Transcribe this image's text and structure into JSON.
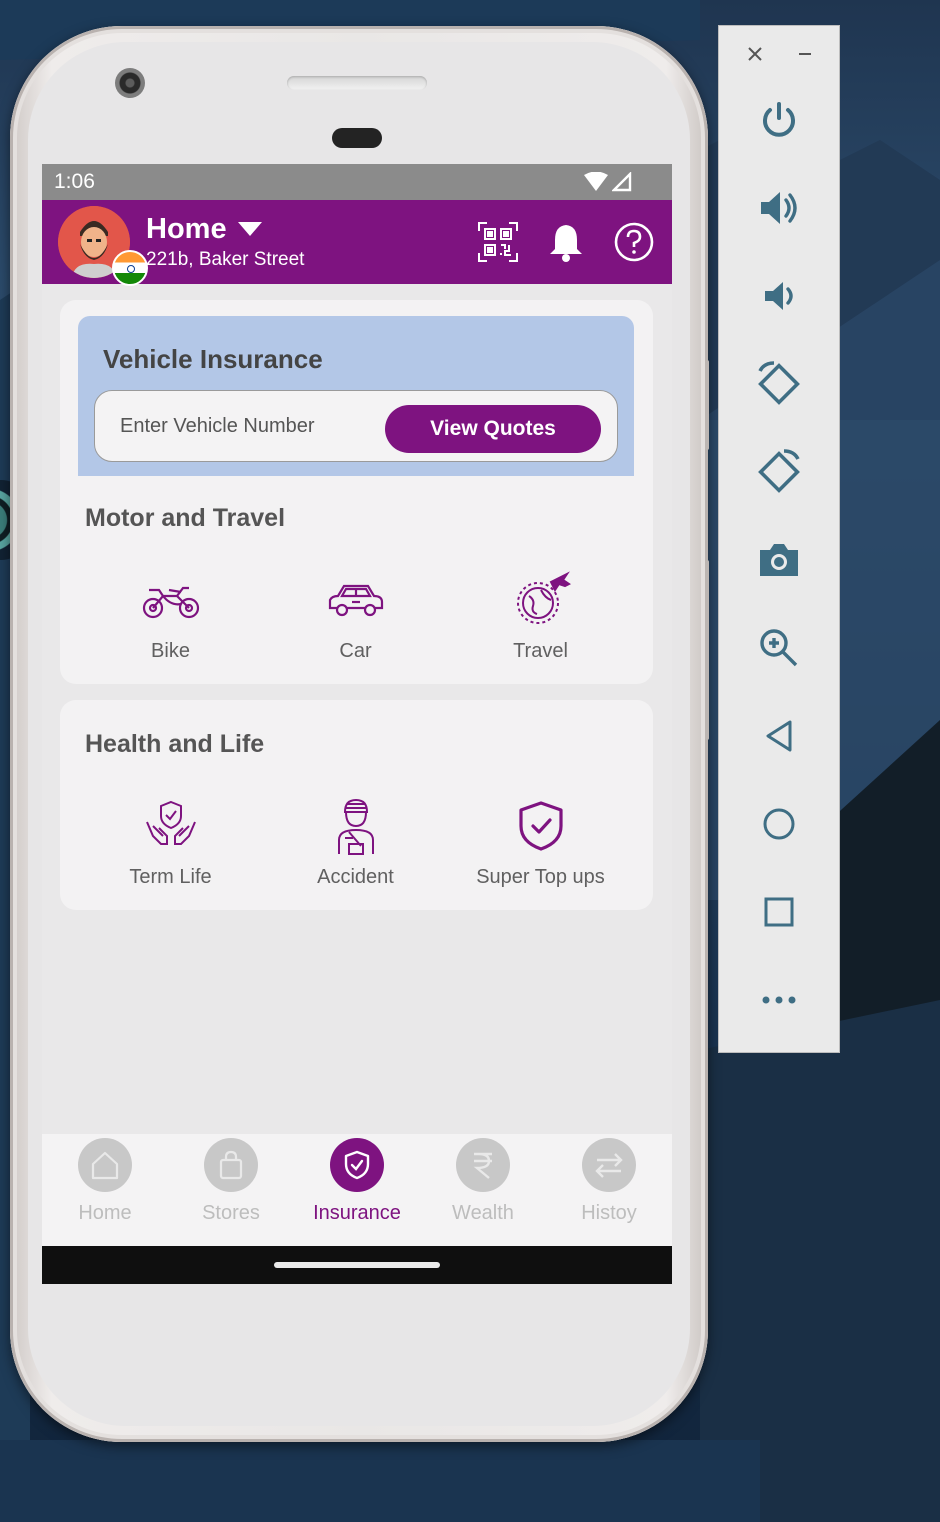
{
  "status_bar": {
    "time": "1:06"
  },
  "app_bar": {
    "location_title": "Home",
    "location_subtitle": "221b, Baker Street"
  },
  "vehicle_insurance": {
    "title": "Vehicle Insurance",
    "input_placeholder": "Enter Vehicle Number",
    "button_label": "View Quotes"
  },
  "motor_travel": {
    "title": "Motor and Travel",
    "items": [
      {
        "label": "Bike",
        "icon": "bike-icon"
      },
      {
        "label": "Car",
        "icon": "car-icon"
      },
      {
        "label": "Travel",
        "icon": "travel-icon"
      }
    ]
  },
  "health_life": {
    "title": "Health and Life",
    "items": [
      {
        "label": "Term Life",
        "icon": "term-life-icon"
      },
      {
        "label": "Accident",
        "icon": "accident-icon"
      },
      {
        "label": "Super Top ups",
        "icon": "shield-check-icon"
      }
    ]
  },
  "bottom_nav": {
    "items": [
      {
        "label": "Home",
        "icon": "home-icon",
        "active": false
      },
      {
        "label": "Stores",
        "icon": "shopping-bag-icon",
        "active": false
      },
      {
        "label": "Insurance",
        "icon": "shield-icon",
        "active": true
      },
      {
        "label": "Wealth",
        "icon": "rupee-icon",
        "active": false
      },
      {
        "label": "Histoy",
        "icon": "swap-icon",
        "active": false
      }
    ]
  },
  "colors": {
    "brand": "#7e1380",
    "vehicle_box": "#b3c7e7",
    "inactive": "#c8c8c8"
  },
  "emulator_toolbar": {
    "buttons": [
      "close-icon",
      "minimize-icon",
      "power-icon",
      "volume-up-icon",
      "volume-down-icon",
      "rotate-left-icon",
      "rotate-right-icon",
      "camera-icon",
      "zoom-icon",
      "back-icon",
      "home-circle-icon",
      "overview-icon",
      "more-icon"
    ]
  }
}
